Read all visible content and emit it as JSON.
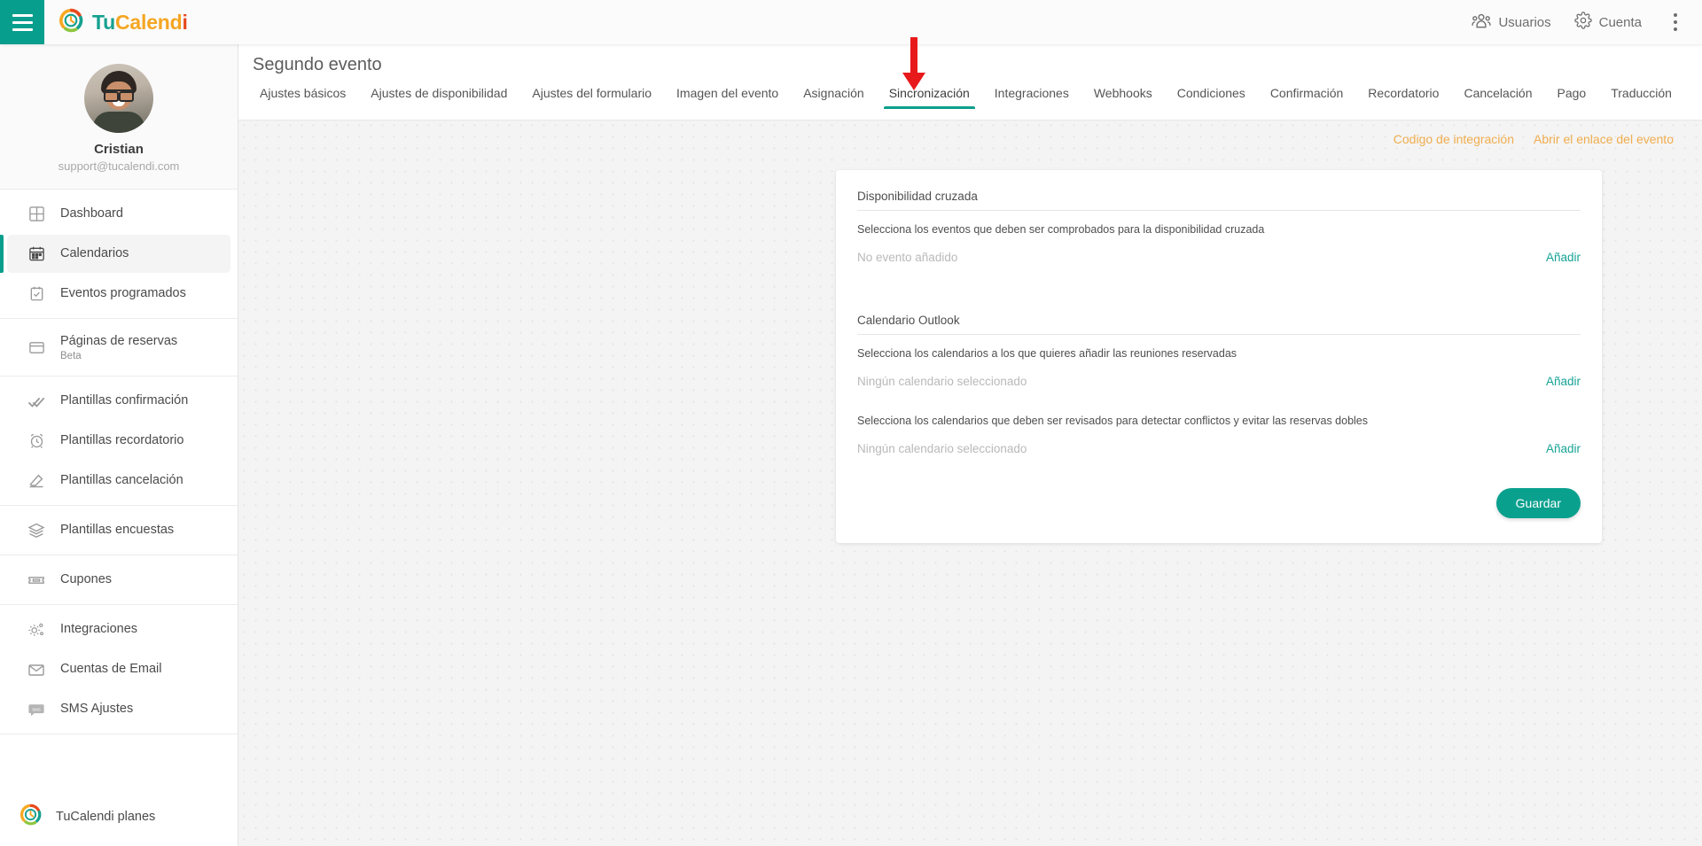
{
  "topbar": {
    "menu_icon": "hamburger-icon",
    "brand": {
      "part1": "Tu",
      "part2": "Calend",
      "part3": "i"
    },
    "users_label": "Usuarios",
    "account_label": "Cuenta",
    "users_icon": "users-icon",
    "account_icon": "gear-icon",
    "overflow_icon": "kebab-menu-icon"
  },
  "sidebar": {
    "profile": {
      "name": "Cristian",
      "email": "support@tucalendi.com",
      "avatar": "user-avatar"
    },
    "groups": [
      {
        "items": [
          {
            "label": "Dashboard",
            "icon": "dashboard-grid-icon",
            "active": false
          },
          {
            "label": "Calendarios",
            "icon": "calendar-icon",
            "active": true
          },
          {
            "label": "Eventos programados",
            "icon": "calendar-check-icon",
            "active": false
          }
        ]
      },
      {
        "items": [
          {
            "label": "Páginas de reservas",
            "sub": "Beta",
            "icon": "window-icon",
            "active": false
          }
        ]
      },
      {
        "items": [
          {
            "label": "Plantillas confirmación",
            "icon": "double-check-icon",
            "active": false
          },
          {
            "label": "Plantillas recordatorio",
            "icon": "alarm-clock-icon",
            "active": false
          },
          {
            "label": "Plantillas cancelación",
            "icon": "eraser-icon",
            "active": false
          }
        ]
      },
      {
        "items": [
          {
            "label": "Plantillas encuestas",
            "icon": "layers-icon",
            "active": false
          }
        ]
      },
      {
        "items": [
          {
            "label": "Cupones",
            "icon": "ticket-icon",
            "active": false
          }
        ]
      },
      {
        "items": [
          {
            "label": "Integraciones",
            "icon": "gears-icon",
            "active": false
          },
          {
            "label": "Cuentas de Email",
            "icon": "envelope-icon",
            "active": false
          },
          {
            "label": "SMS Ajustes",
            "icon": "sms-bubble-icon",
            "active": false
          }
        ]
      }
    ],
    "footer": {
      "label": "TuCalendi planes",
      "icon": "tucalendi-logo-icon"
    }
  },
  "header": {
    "title": "Segundo evento",
    "tabs": [
      {
        "label": "Ajustes básicos",
        "active": false
      },
      {
        "label": "Ajustes de disponibilidad",
        "active": false
      },
      {
        "label": "Ajustes del formulario",
        "active": false
      },
      {
        "label": "Imagen del evento",
        "active": false
      },
      {
        "label": "Asignación",
        "active": false
      },
      {
        "label": "Sincronización",
        "active": true
      },
      {
        "label": "Integraciones",
        "active": false
      },
      {
        "label": "Webhooks",
        "active": false
      },
      {
        "label": "Condiciones",
        "active": false
      },
      {
        "label": "Confirmación",
        "active": false
      },
      {
        "label": "Recordatorio",
        "active": false
      },
      {
        "label": "Cancelación",
        "active": false
      },
      {
        "label": "Pago",
        "active": false
      },
      {
        "label": "Traducción",
        "active": false
      }
    ]
  },
  "quicklinks": [
    {
      "label": "Codigo de integración"
    },
    {
      "label": "Abrir el enlace del evento"
    }
  ],
  "card": {
    "cross_availability": {
      "title": "Disponibilidad cruzada",
      "description": "Selecciona los eventos que deben ser comprobados para la disponibilidad cruzada",
      "empty_value": "No evento añadido",
      "add_label": "Añadir"
    },
    "outlook_calendar": {
      "title": "Calendario Outlook",
      "description_add": "Selecciona los calendarios a los que quieres añadir las reuniones reservadas",
      "empty_add": "Ningún calendario seleccionado",
      "add_label_1": "Añadir",
      "description_check": "Selecciona los calendarios que deben ser revisados para detectar conflictos y evitar las reservas dobles",
      "empty_check": "Ningún calendario seleccionado",
      "add_label_2": "Añadir"
    },
    "save_label": "Guardar"
  },
  "annotation": {
    "arrow": "red-down-arrow",
    "color": "#e8191b",
    "points_to": "Sincronización"
  },
  "colors": {
    "brand_teal": "#089e8e",
    "accent_orange": "#f0ad4e",
    "link_teal": "#17a396",
    "annotation_red": "#e8191b"
  }
}
